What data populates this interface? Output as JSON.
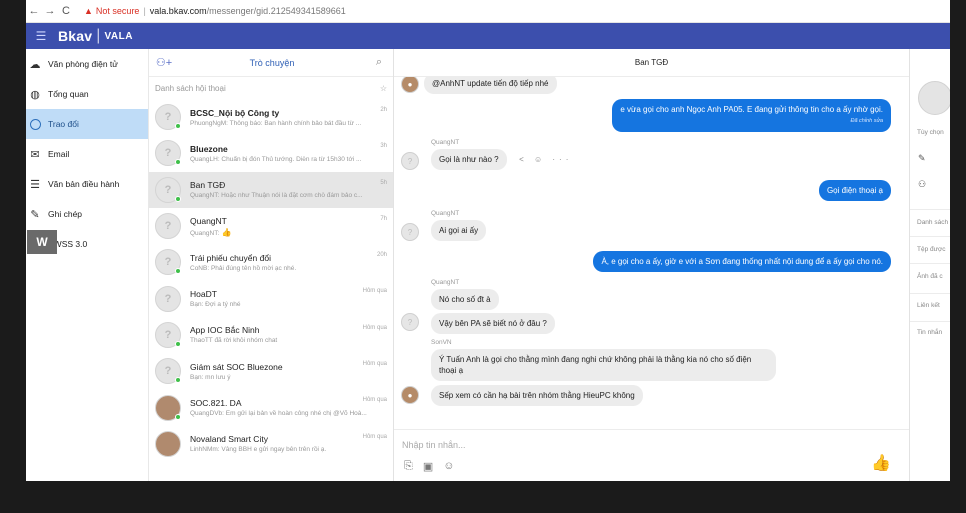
{
  "browser": {
    "back": "←",
    "forward": "→",
    "reload": "C",
    "not_secure": "Not secure",
    "url_host": "vala.bkav.com",
    "url_path": "/messenger/gid.2125493415896​61"
  },
  "app": {
    "logo": "Bkav",
    "logo_sub": "VALA"
  },
  "leftnav": {
    "items": [
      {
        "label": "Văn phòng điện tử",
        "icon": "cloud-icon"
      },
      {
        "label": "Tổng quan",
        "icon": "globe-icon"
      },
      {
        "label": "Trao đổi",
        "icon": "chat-circle-icon",
        "active": true
      },
      {
        "label": "Email",
        "icon": "mail-icon"
      },
      {
        "label": "Văn bản điều hành",
        "icon": "document-icon"
      },
      {
        "label": "Ghi chép",
        "icon": "note-icon"
      },
      {
        "label": "EWSS 3.0",
        "icon": "ewss-icon"
      }
    ],
    "wk_label": "W"
  },
  "convlist": {
    "tab": "Trò chuyện",
    "subheader": "Danh sách hội thoại",
    "items": [
      {
        "name": "BCSC_Nội bộ Công ty",
        "preview": "PhuongNgM: Thông báo: Ban hành chính bảo bát đầu từ ...",
        "time": "2h",
        "bold": true,
        "online": true,
        "avatar": "?"
      },
      {
        "name": "Bluezone",
        "preview": "QuangLH: Chuẩn bị đón Thủ tướng. Diễn ra từ 15h30 tới ...",
        "time": "3h",
        "bold": true,
        "online": true,
        "avatar": "?"
      },
      {
        "name": "Ban TGĐ",
        "preview": "QuangNT: Hoặc như Thuận nói là đặt cơm chỗ đám bảo c...",
        "time": "5h",
        "bold": false,
        "online": true,
        "avatar": "?",
        "selected": true
      },
      {
        "name": "QuangNT",
        "preview": "QuangNT:",
        "time": "7h",
        "bold": false,
        "online": false,
        "avatar": "?"
      },
      {
        "name": "Trái phiếu chuyển đổi",
        "preview": "CoNB: Phải đúng tên hồ mời ạc nhé.",
        "time": "20h",
        "bold": false,
        "online": true,
        "avatar": "?"
      },
      {
        "name": "HoaDT",
        "preview": "Bạn: Đợi a tý nhé",
        "time": "Hôm qua",
        "bold": false,
        "online": false,
        "avatar": "?"
      },
      {
        "name": "App IOC Bắc Ninh",
        "preview": "ThaoTT đã rời khỏi nhóm chat",
        "time": "Hôm qua",
        "bold": false,
        "online": true,
        "avatar": "?"
      },
      {
        "name": "Giám sát SOC Bluezone",
        "preview": "Bạn: mn lưu ý",
        "time": "Hôm qua",
        "bold": false,
        "online": true,
        "avatar": "?"
      },
      {
        "name": "SOC.821. DA",
        "preview": "QuangDVb: Em gửi lại bản về hoàn công nhé chị @Võ Hoà...",
        "time": "Hôm qua",
        "bold": false,
        "online": true,
        "avatar": "photo"
      },
      {
        "name": "Novaland Smart City",
        "preview": "LinhNMm: Vâng BBH e gửi ngay bên trên rồi ạ.",
        "time": "Hôm qua",
        "bold": false,
        "online": false,
        "avatar": "photo"
      }
    ]
  },
  "chat": {
    "title": "Ban TGĐ",
    "messages": [
      {
        "text": "@AnhNT update tiến độ tiếp nhé",
        "dir": "in"
      },
      {
        "text": "e vừa gọi cho anh Ngọc Anh PA05. E đang gửi thông tin cho a ấy nhờ gọi.",
        "edited": "Đã chỉnh sửa",
        "dir": "out"
      },
      {
        "sender": "QuangNT",
        "text": "Gọi là như nào ?",
        "dir": "in"
      },
      {
        "text": "Gọi điện thoại ạ",
        "dir": "out"
      },
      {
        "sender": "QuangNT",
        "text": "Ai gọi ai ấy",
        "dir": "in"
      },
      {
        "text": "À, e gọi cho a ấy, giờ e với a Sơn đang thống nhất nội dung  để a ấy gọi cho nó.",
        "dir": "out"
      },
      {
        "sender": "QuangNT",
        "text": "Nó cho số đt à",
        "dir": "in"
      },
      {
        "text": "Vậy bên PA sẽ biết nó ở đâu ?",
        "dir": "in"
      },
      {
        "sender": "SonVN",
        "text": "Ý Tuấn Anh là gọi cho thằng mình đang nghi chứ không phải là thằng kia nó cho số điện thoại ạ",
        "dir": "in"
      },
      {
        "text": "Sếp xem có cần hạ bài trên nhóm thằng HieuPC không",
        "dir": "in"
      }
    ],
    "msg_actions": "< ☺ ···",
    "composer_placeholder": "Nhập tin nhắn..."
  },
  "rpanel": {
    "items": [
      "Tùy chọn",
      "Danh sách",
      "Tệp được",
      "Ảnh đã c",
      "Liên kết",
      "Tin nhắn"
    ]
  }
}
